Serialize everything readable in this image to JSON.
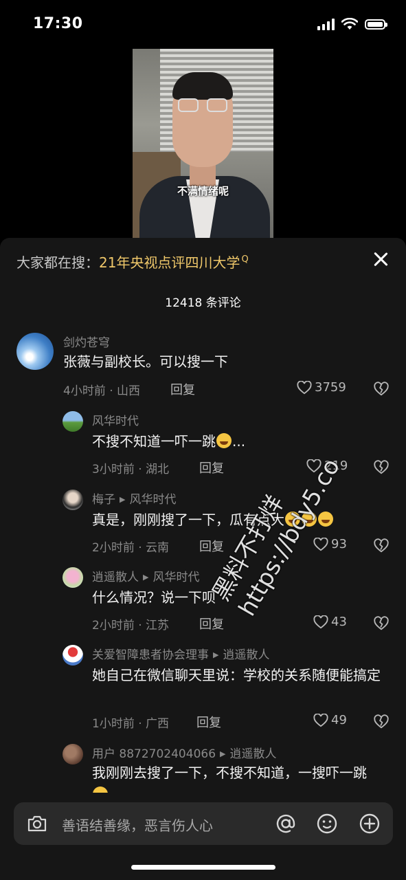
{
  "status_bar": {
    "time": "17:30"
  },
  "video": {
    "subtitle": "不满情绪呢"
  },
  "search_hint": {
    "prefix": "大家都在搜：",
    "keyword": "21年央视点评四川大学",
    "search_glyph": "Q"
  },
  "comment_count": "12418 条评论",
  "reply_label": "回复",
  "comments": [
    {
      "user": "剑灼苍穹",
      "text": "张薇与副校长。可以搜一下",
      "meta": "4小时前 · 山西",
      "likes": "3759"
    },
    {
      "user": "风华时代",
      "text": "不搜不知道一吓一跳",
      "suffix": "...",
      "meta": "3小时前 · 湖北",
      "likes": "219"
    },
    {
      "user": "梅子",
      "reply_to": "风华时代",
      "text": "真是，刚刚搜了一下，瓜有点大",
      "meta": "2小时前 · 云南",
      "likes": "93"
    },
    {
      "user": "逍遥散人",
      "reply_to": "风华时代",
      "text": "什么情况？说一下呗",
      "meta": "2小时前 · 江苏",
      "likes": "43"
    },
    {
      "user": "关爱智障患者协会理事",
      "reply_to": "逍遥散人",
      "text": "她自己在微信聊天里说：学校的关系随便能搞定",
      "meta": "1小时前 · 广西",
      "likes": "49"
    },
    {
      "user": "用户 8872702404066",
      "reply_to": "逍遥散人",
      "text": "我刚刚去搜了一下，不搜不知道，一搜吓一跳"
    }
  ],
  "input": {
    "placeholder": "善语结善缘，恶言伤人心"
  },
  "watermark": {
    "line1": "黑料不打烊",
    "line2": "https://bdy5.co"
  },
  "colors": {
    "sheet": "#161616",
    "keyword": "#f0c86a",
    "muted": "#8a8a8a"
  }
}
